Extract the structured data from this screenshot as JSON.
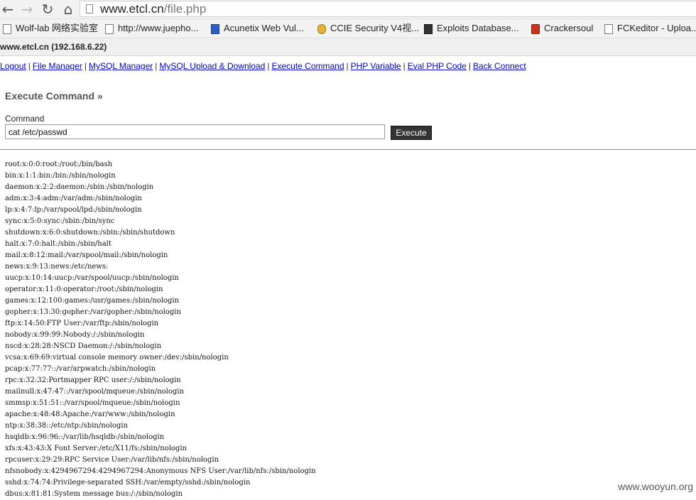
{
  "browser": {
    "url_host": "www.etcl.cn",
    "url_path": "/file.php",
    "back_glyph": "←",
    "forward_glyph": "→",
    "reload_glyph": "↻",
    "home_glyph": "⌂"
  },
  "bookmarks": [
    {
      "label": "Wolf-lab 网络实验室",
      "icon": "page-icon"
    },
    {
      "label": "http://www.juepho...",
      "icon": "page-icon"
    },
    {
      "label": "Acunetix Web Vul...",
      "icon": "acunetix-icon"
    },
    {
      "label": "CCIE Security V4视...",
      "icon": "ccie-icon"
    },
    {
      "label": "Exploits Database...",
      "icon": "exploitdb-icon"
    },
    {
      "label": "Crackersoul",
      "icon": "crackersoul-icon"
    },
    {
      "label": "FCKeditor - Uploa...",
      "icon": "page-icon"
    }
  ],
  "host": "www.etcl.cn (192.168.6.22)",
  "menu": {
    "items": [
      "Logout",
      "File Manager",
      "MySQL Manager",
      "MySQL Upload & Download",
      "Execute Command",
      "PHP Variable",
      "Eval PHP Code",
      "Back Connect"
    ],
    "separator": "|"
  },
  "execute": {
    "title": "Execute Command »",
    "label": "Command",
    "value": "cat /etc/passwd",
    "button": "Execute"
  },
  "output_lines": [
    "root:x:0:0:root:/root:/bin/bash",
    "bin:x:1:1:bin:/bin:/sbin/nologin",
    "daemon:x:2:2:daemon:/sbin:/sbin/nologin",
    "adm:x:3:4:adm:/var/adm:/sbin/nologin",
    "lp:x:4:7:lp:/var/spool/lpd:/sbin/nologin",
    "sync:x:5:0:sync:/sbin:/bin/sync",
    "shutdown:x:6:0:shutdown:/sbin:/sbin/shutdown",
    "halt:x:7:0:halt:/sbin:/sbin/halt",
    "mail:x:8:12:mail:/var/spool/mail:/sbin/nologin",
    "news:x:9:13:news:/etc/news:",
    "uucp:x:10:14:uucp:/var/spool/uucp:/sbin/nologin",
    "operator:x:11:0:operator:/root:/sbin/nologin",
    "games:x:12:100:games:/usr/games:/sbin/nologin",
    "gopher:x:13:30:gopher:/var/gopher:/sbin/nologin",
    "ftp:x:14:50:FTP User:/var/ftp:/sbin/nologin",
    "nobody:x:99:99:Nobody:/:/sbin/nologin",
    "nscd:x:28:28:NSCD Daemon:/:/sbin/nologin",
    "vcsa:x:69:69:virtual console memory owner:/dev:/sbin/nologin",
    "pcap:x:77:77::/var/arpwatch:/sbin/nologin",
    "rpc:x:32:32:Portmapper RPC user:/:/sbin/nologin",
    "mailnull:x:47:47::/var/spool/mqueue:/sbin/nologin",
    "smmsp:x:51:51::/var/spool/mqueue:/sbin/nologin",
    "apache:x:48:48:Apache:/var/www:/sbin/nologin",
    "ntp:x:38:38::/etc/ntp:/sbin/nologin",
    "hsqldb:x:96:96::/var/lib/hsqldb:/sbin/nologin",
    "xfs:x:43:43:X Font Server:/etc/X11/fs:/sbin/nologin",
    "rpcuser:x:29:29:RPC Service User:/var/lib/nfs:/sbin/nologin",
    "nfsnobody:x:4294967294:4294967294:Anonymous NFS User:/var/lib/nfs:/sbin/nologin",
    "sshd:x:74:74:Privilege-separated SSH:/var/empty/sshd:/sbin/nologin",
    "dbus:x:81:81:System message bus:/:/sbin/nologin"
  ],
  "watermark": "www.wooyun.org"
}
